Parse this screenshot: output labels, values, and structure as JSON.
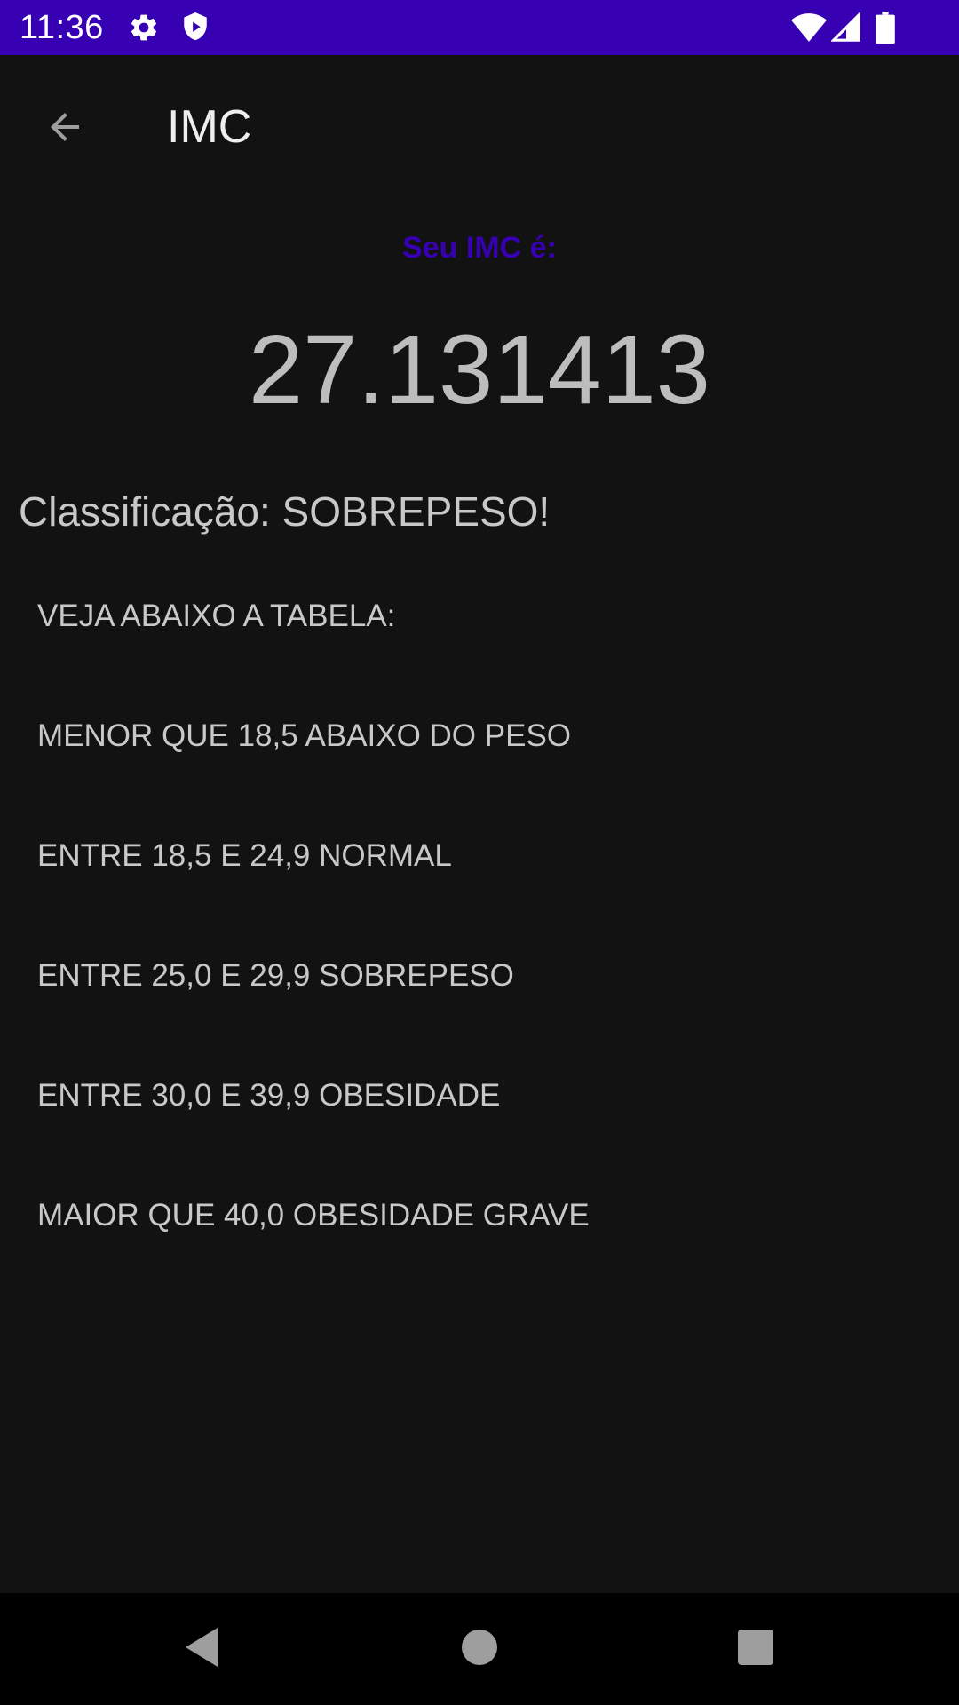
{
  "status_bar": {
    "time": "11:36",
    "icons": [
      "gear-icon",
      "shield-icon",
      "wifi-icon",
      "signal-icon",
      "battery-icon"
    ],
    "background": "#3700b3"
  },
  "app_bar": {
    "title": "IMC",
    "back_icon": "arrow-back-icon"
  },
  "result": {
    "label": "Seu IMC é:",
    "value": "27.131413",
    "classification": "Classificação: SOBREPESO!",
    "label_color": "#3700b3"
  },
  "table": {
    "header": "VEJA ABAIXO A TABELA:",
    "rows": [
      "MENOR QUE 18,5 ABAIXO DO PESO",
      "ENTRE 18,5 E 24,9 NORMAL",
      "ENTRE 25,0 E 29,9 SOBREPESO",
      "ENTRE 30,0 E 39,9 OBESIDADE",
      "MAIOR QUE 40,0 OBESIDADE GRAVE"
    ]
  },
  "nav_bar": {
    "icons": [
      "back-triangle-icon",
      "home-circle-icon",
      "recents-square-icon"
    ]
  }
}
